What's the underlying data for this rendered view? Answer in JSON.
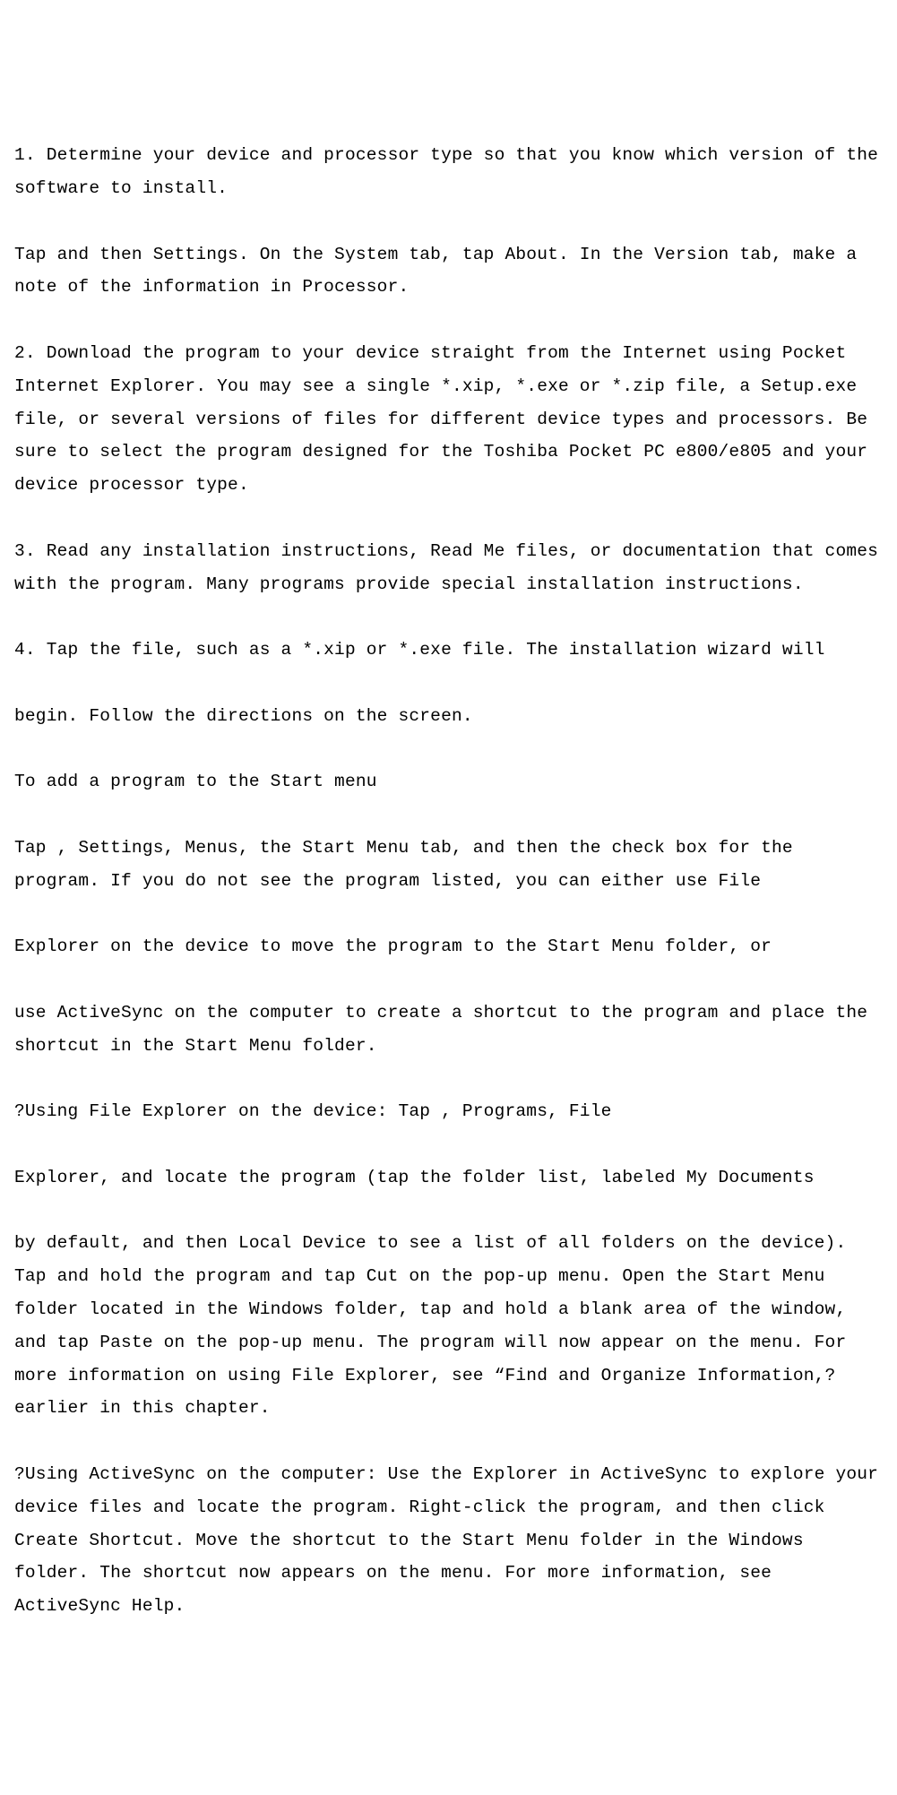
{
  "lines": [
    "1. Determine your device and processor type so that you know which version of the software to install.",
    "Tap and then Settings. On the System tab, tap About. In the Version tab, make a note of the information in Processor.",
    "2. Download the program to your device straight from the Internet using Pocket Internet Explorer. You may see a single *.xip, *.exe or *.zip file, a Setup.exe file, or several versions of files for different device types and processors. Be sure to select the program designed for the Toshiba Pocket PC e800/e805 and your device processor type.",
    "3. Read any installation instructions, Read Me files, or documentation that comes with the program. Many programs provide special installation instructions.",
    "4. Tap the file, such as a *.xip or *.exe file. The installation wizard will",
    "begin. Follow the directions on the screen.",
    "To add a program to the Start menu",
    "Tap , Settings, Menus, the Start Menu tab, and then the check box for the program. If you do not see the program listed, you can either use File",
    "Explorer on the device to move the program to the Start Menu folder, or",
    "use ActiveSync on the computer to create a shortcut to the program and place the shortcut in the Start Menu folder.",
    "?Using File Explorer on the device: Tap , Programs, File",
    "Explorer, and locate the program (tap the folder list, labeled My Documents",
    "by default, and then Local Device to see a list of all folders on the device). Tap and hold the program and tap Cut on the pop-up menu. Open the Start Menu folder located in the Windows folder, tap and hold a blank area of the window, and tap Paste on the pop-up menu. The program will now appear on the menu. For more information on using File Explorer, see “Find and Organize Information,?earlier in this chapter.",
    "?Using ActiveSync on the computer: Use the Explorer in ActiveSync to explore your device files and locate the program. Right-click the program, and then click Create Shortcut. Move the shortcut to the Start Menu folder in the Windows folder. The shortcut now appears on the menu. For more information, see ActiveSync Help."
  ]
}
